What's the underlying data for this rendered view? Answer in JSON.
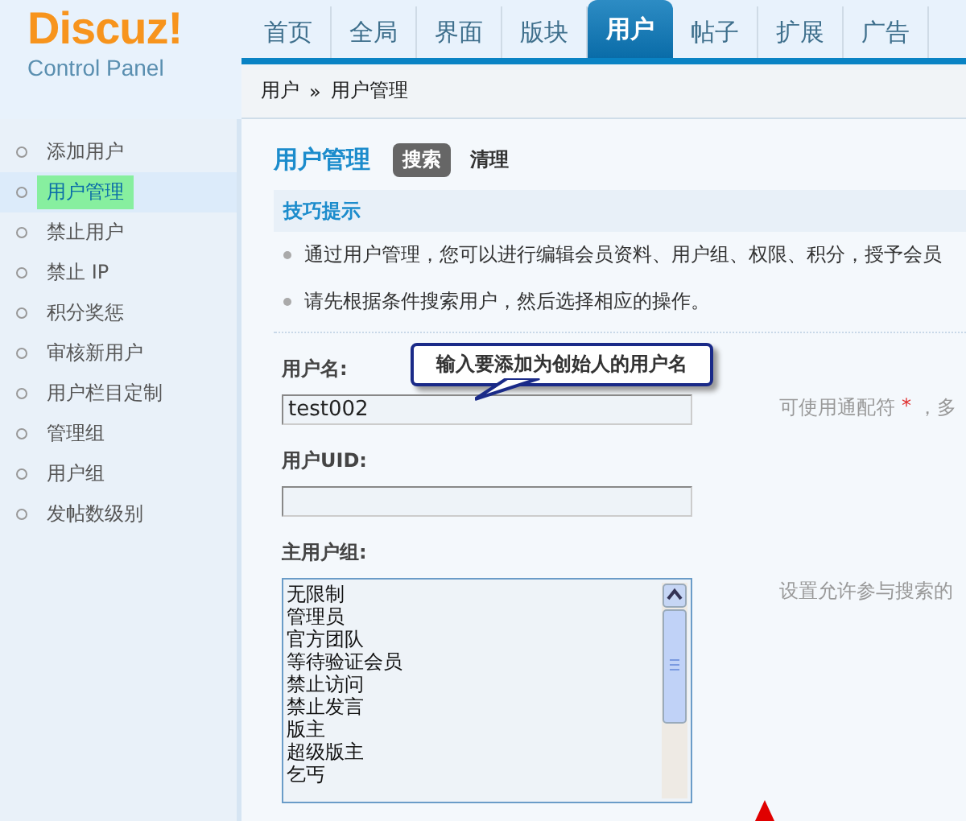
{
  "logo": {
    "title": "Discuz!",
    "subtitle": "Control Panel"
  },
  "nav_tabs": [
    {
      "label": "首页",
      "selected": false
    },
    {
      "label": "全局",
      "selected": false
    },
    {
      "label": "界面",
      "selected": false
    },
    {
      "label": "版块",
      "selected": false
    },
    {
      "label": "用户",
      "selected": true
    },
    {
      "label": "帖子",
      "selected": false
    },
    {
      "label": "扩展",
      "selected": false
    },
    {
      "label": "广告",
      "selected": false
    }
  ],
  "breadcrumb": {
    "items": [
      "用户",
      "用户管理"
    ],
    "separator": "»"
  },
  "sidebar": {
    "items": [
      {
        "label": "添加用户",
        "selected": false
      },
      {
        "label": "用户管理",
        "selected": true
      },
      {
        "label": "禁止用户",
        "selected": false
      },
      {
        "label": "禁止 IP",
        "selected": false
      },
      {
        "label": "积分奖惩",
        "selected": false
      },
      {
        "label": "审核新用户",
        "selected": false
      },
      {
        "label": "用户栏目定制",
        "selected": false
      },
      {
        "label": "管理组",
        "selected": false
      },
      {
        "label": "用户组",
        "selected": false
      },
      {
        "label": "发帖数级别",
        "selected": false
      }
    ]
  },
  "page_title": "用户管理",
  "sub_tabs": [
    {
      "label": "搜索",
      "selected": true
    },
    {
      "label": "清理",
      "selected": false
    }
  ],
  "tips": {
    "title": "技巧提示",
    "items": [
      "通过用户管理，您可以进行编辑会员资料、用户组、权限、积分，授予会员",
      "请先根据条件搜索用户，然后选择相应的操作。"
    ]
  },
  "callout": "输入要添加为创始人的用户名",
  "fields": [
    {
      "kind": "text",
      "label": "用户名:",
      "value": "test002",
      "hint": "可使用通配符",
      "hint_mark": "*",
      "hint_tail": "，多"
    },
    {
      "kind": "text",
      "label": "用户UID:"
    },
    {
      "kind": "list",
      "label": "主用户组:",
      "options": [
        "无限制",
        "管理员",
        "官方团队",
        "等待验证会员",
        "禁止访问",
        "禁止发言",
        "版主",
        "超级版主",
        "乞丐"
      ],
      "hint": "设置允许参与搜索的"
    }
  ]
}
